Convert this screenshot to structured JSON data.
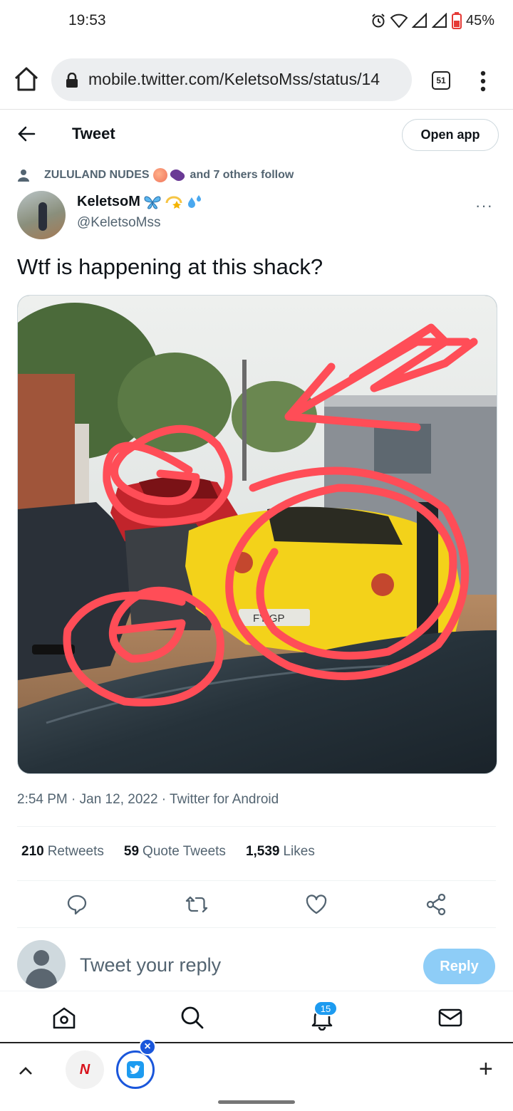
{
  "status": {
    "time": "19:53",
    "battery": "45%"
  },
  "browser": {
    "url": "mobile.twitter.com/KeletsoMss/status/14",
    "tab_count": "51"
  },
  "header": {
    "title": "Tweet",
    "open_app": "Open app"
  },
  "social_context": {
    "name": "ZULULAND NUDES",
    "suffix": "and 7 others follow"
  },
  "author": {
    "name": "KeletsoM",
    "handle": "@KeletsoMss",
    "more": "···"
  },
  "tweet": {
    "text": "Wtf is happening at this shack?",
    "timestamp": "2:54 PM · Jan 12, 2022 · Twitter for Android",
    "plate_text": "FY-GP"
  },
  "stats": {
    "retweets_count": "210",
    "retweets_label": "Retweets",
    "quotes_count": "59",
    "quotes_label": "Quote Tweets",
    "likes_count": "1,539",
    "likes_label": "Likes"
  },
  "reply": {
    "placeholder": "Tweet your reply",
    "button": "Reply"
  },
  "nav": {
    "notifications_badge": "15"
  },
  "tabs": {
    "news_tab": "N",
    "new_tab": "+"
  },
  "colors": {
    "twitter_blue": "#1d9bf0",
    "reply_disabled": "#8ecdf7",
    "annotation_red": "#ff4d57",
    "ferrari_yellow": "#f3d21a"
  }
}
